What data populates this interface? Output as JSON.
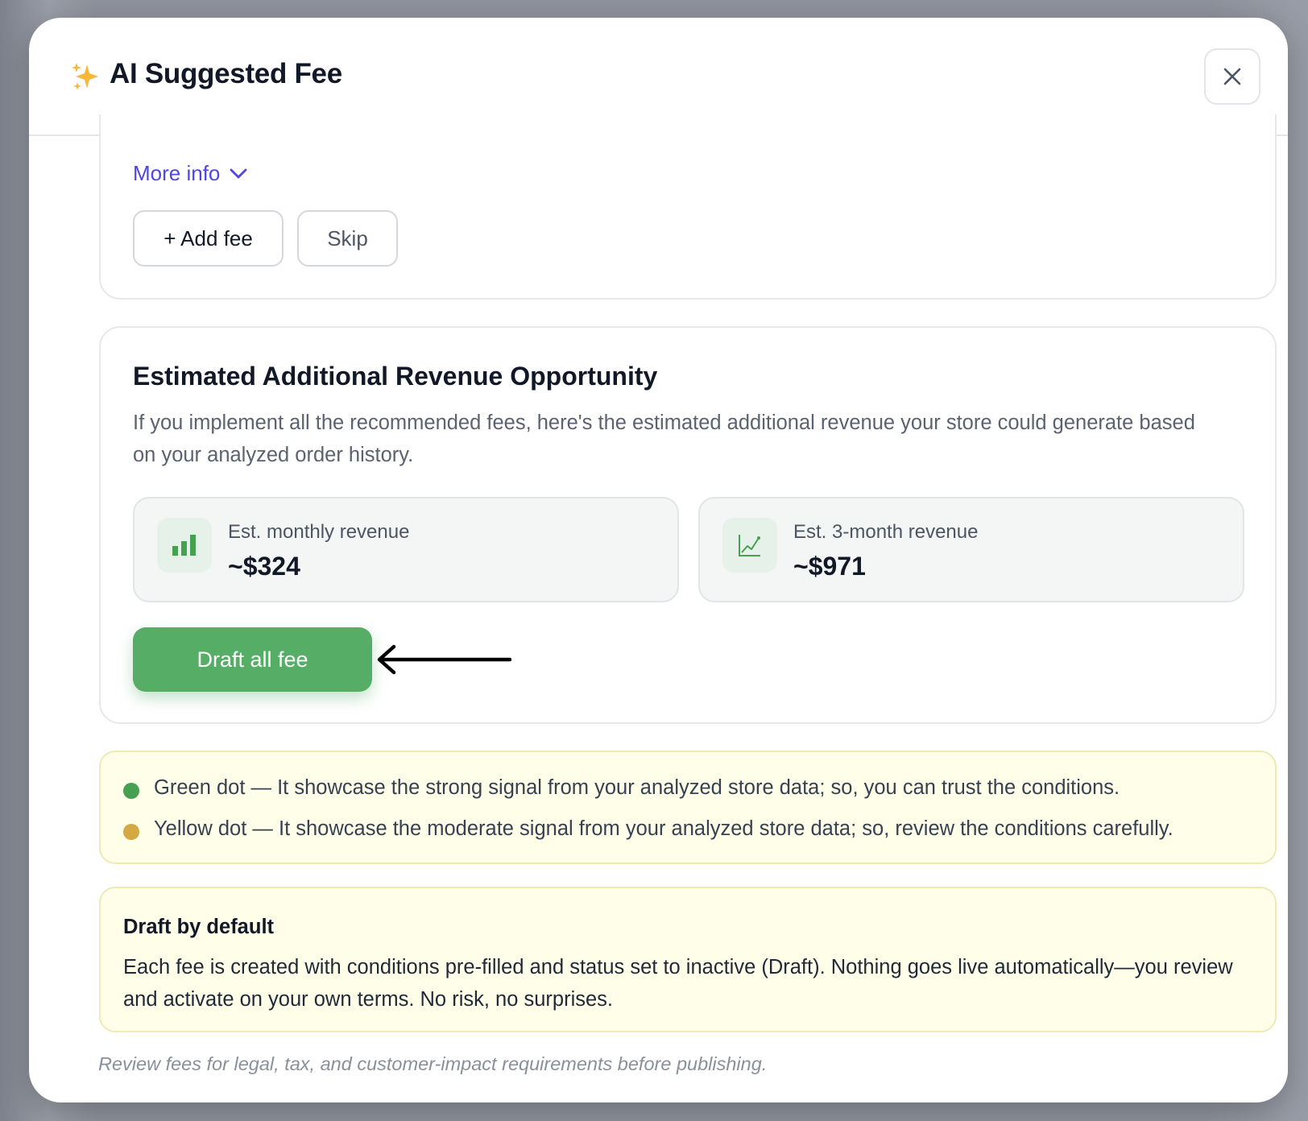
{
  "modal": {
    "title": "AI Suggested Fee",
    "close_icon": "close-icon",
    "sparkle_icon": "sparkles-icon"
  },
  "fee_card": {
    "more_info_label": "More info",
    "add_fee_label": "+ Add fee",
    "skip_label": "Skip"
  },
  "revenue": {
    "title": "Estimated Additional Revenue Opportunity",
    "description": "If you implement all the recommended fees, here's the estimated additional revenue your store could generate based on your analyzed order history.",
    "monthly": {
      "label": "Est. monthly revenue",
      "value": "~$324",
      "icon": "bar-chart-icon"
    },
    "three_month": {
      "label": "Est. 3-month revenue",
      "value": "~$971",
      "icon": "line-chart-icon"
    },
    "draft_all_label": "Draft all fee"
  },
  "legend": {
    "green": "Green dot — It showcase the strong signal from your analyzed store data; so, you can trust the conditions.",
    "yellow": "Yellow dot — It showcase the moderate signal from your analyzed store data; so, review the conditions carefully."
  },
  "draft_notice": {
    "title": "Draft by default",
    "body": "Each fee is created with conditions pre-filled and status set to inactive (Draft). Nothing goes live automatically—you review and activate on your own terms. No risk, no surprises."
  },
  "footnote": "Review fees for legal, tax, and customer-impact requirements before publishing.",
  "colors": {
    "accent_green": "#56ad66",
    "link": "#4f46e5",
    "green_dot": "#45a050",
    "yellow_dot": "#d4a843",
    "notice_bg": "#fefee9"
  }
}
